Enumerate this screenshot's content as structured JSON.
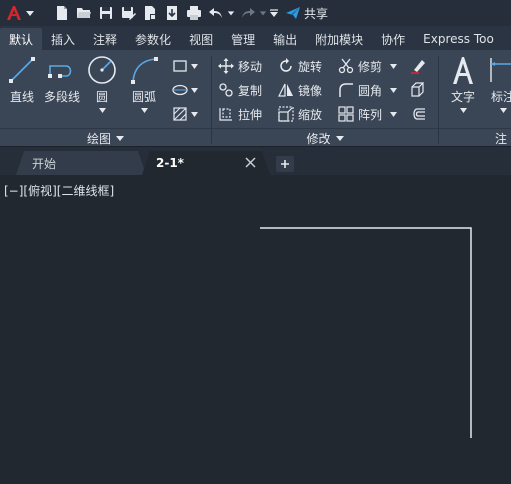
{
  "share_label": "共享",
  "tabs": [
    {
      "label": "默认",
      "active": true
    },
    {
      "label": "插入"
    },
    {
      "label": "注释"
    },
    {
      "label": "参数化"
    },
    {
      "label": "视图"
    },
    {
      "label": "管理"
    },
    {
      "label": "输出"
    },
    {
      "label": "附加模块"
    },
    {
      "label": "协作"
    },
    {
      "label": "Express Too"
    }
  ],
  "ribbon": {
    "draw": {
      "title": "绘图",
      "line": "直线",
      "polyline": "多段线",
      "circle": "圆",
      "arc": "圆弧"
    },
    "modify": {
      "title": "修改",
      "move": "移动",
      "rotate": "旋转",
      "trim": "修剪",
      "copy": "复制",
      "mirror": "镜像",
      "fillet": "圆角",
      "stretch": "拉伸",
      "scale": "缩放",
      "array": "阵列"
    },
    "annotation": {
      "text": "文字",
      "dim": "标注",
      "title_partial": "注"
    }
  },
  "doc_tabs": {
    "start": "开始",
    "current": "2-1*"
  },
  "viewport": {
    "label": "[−][俯视][二维线框]"
  },
  "colors": {
    "accent_red": "#d9262c",
    "share_blue": "#2f9be0",
    "icon_blue": "#5aa9e6",
    "icon_white": "#e6e9ee"
  }
}
